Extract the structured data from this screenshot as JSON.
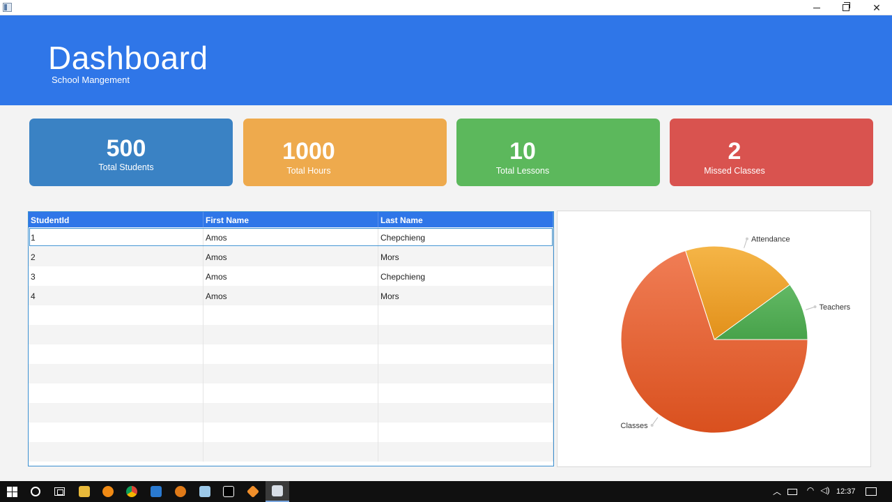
{
  "window": {
    "minimize_label": "",
    "maximize_label": "",
    "close_label": "✕"
  },
  "header": {
    "title": "Dashboard",
    "subtitle": "School Mangement"
  },
  "cards": [
    {
      "value": "500",
      "label": "Total Students",
      "color": "#3a82c4"
    },
    {
      "value": "1000",
      "label": "Total Hours",
      "color": "#eeaa4d"
    },
    {
      "value": "10",
      "label": "Total Lessons",
      "color": "#5cb85c"
    },
    {
      "value": "2",
      "label": "Missed Classes",
      "color": "#d9534f"
    }
  ],
  "table": {
    "columns": [
      "StudentId",
      "First Name",
      "Last Name"
    ],
    "rows": [
      [
        "1",
        "Amos",
        "Chepchieng"
      ],
      [
        "2",
        "Amos",
        "Mors"
      ],
      [
        "3",
        "Amos",
        "Chepchieng"
      ],
      [
        "4",
        "Amos",
        "Mors"
      ]
    ],
    "empty_rows": 8,
    "selected_row": 0
  },
  "chart_data": {
    "type": "pie",
    "slices": [
      {
        "label": "Classes",
        "value": 0.7,
        "color": "#e8643a"
      },
      {
        "label": "Attendance",
        "value": 0.2,
        "color": "#f0a83a"
      },
      {
        "label": "Teachers",
        "value": 0.1,
        "color": "#5cb85c"
      }
    ]
  },
  "taskbar": {
    "apps": [
      "start-icon",
      "cortana-icon",
      "task-view-icon",
      "file-explorer-icon",
      "avast-icon",
      "chrome-icon",
      "vscode-icon",
      "search-app-icon",
      "photos-icon",
      "intellij-icon",
      "sublime-icon",
      "java-app-icon"
    ],
    "clock": "12:37",
    "tray": [
      "chevron-up-icon",
      "battery-icon",
      "wifi-icon",
      "volume-icon"
    ],
    "notifications_icon": "notification-icon"
  }
}
